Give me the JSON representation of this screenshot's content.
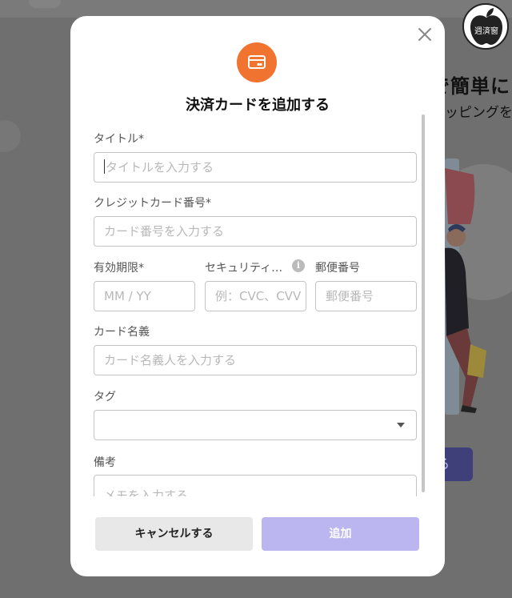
{
  "background": {
    "headline": "で簡単に",
    "subheadline": "ッピングを",
    "button_label": "る",
    "brand_logo_text": "週済窗"
  },
  "modal": {
    "title": "決済カードを追加する",
    "icon": "credit-card-icon",
    "accent_color": "#f07330",
    "fields": {
      "title_label": "タイトル*",
      "title_placeholder": "タイトルを入力する",
      "card_number_label": "クレジットカード番号*",
      "card_number_placeholder": "カード番号を入力する",
      "expiry_label": "有効期限*",
      "expiry_placeholder": "MM / YY",
      "security_label": "セキュリティ…",
      "security_placeholder": "例：CVC、CVV",
      "postal_label": "郵便番号",
      "postal_placeholder": "郵便番号",
      "cardholder_label": "カード名義",
      "cardholder_placeholder": "カード名義人を入力する",
      "tag_label": "タグ",
      "tag_value": "",
      "notes_label": "備考",
      "notes_placeholder": "メモを入力する"
    },
    "buttons": {
      "cancel": "キャンセルする",
      "add": "追加"
    },
    "add_button_color": "#bcb6f0"
  }
}
